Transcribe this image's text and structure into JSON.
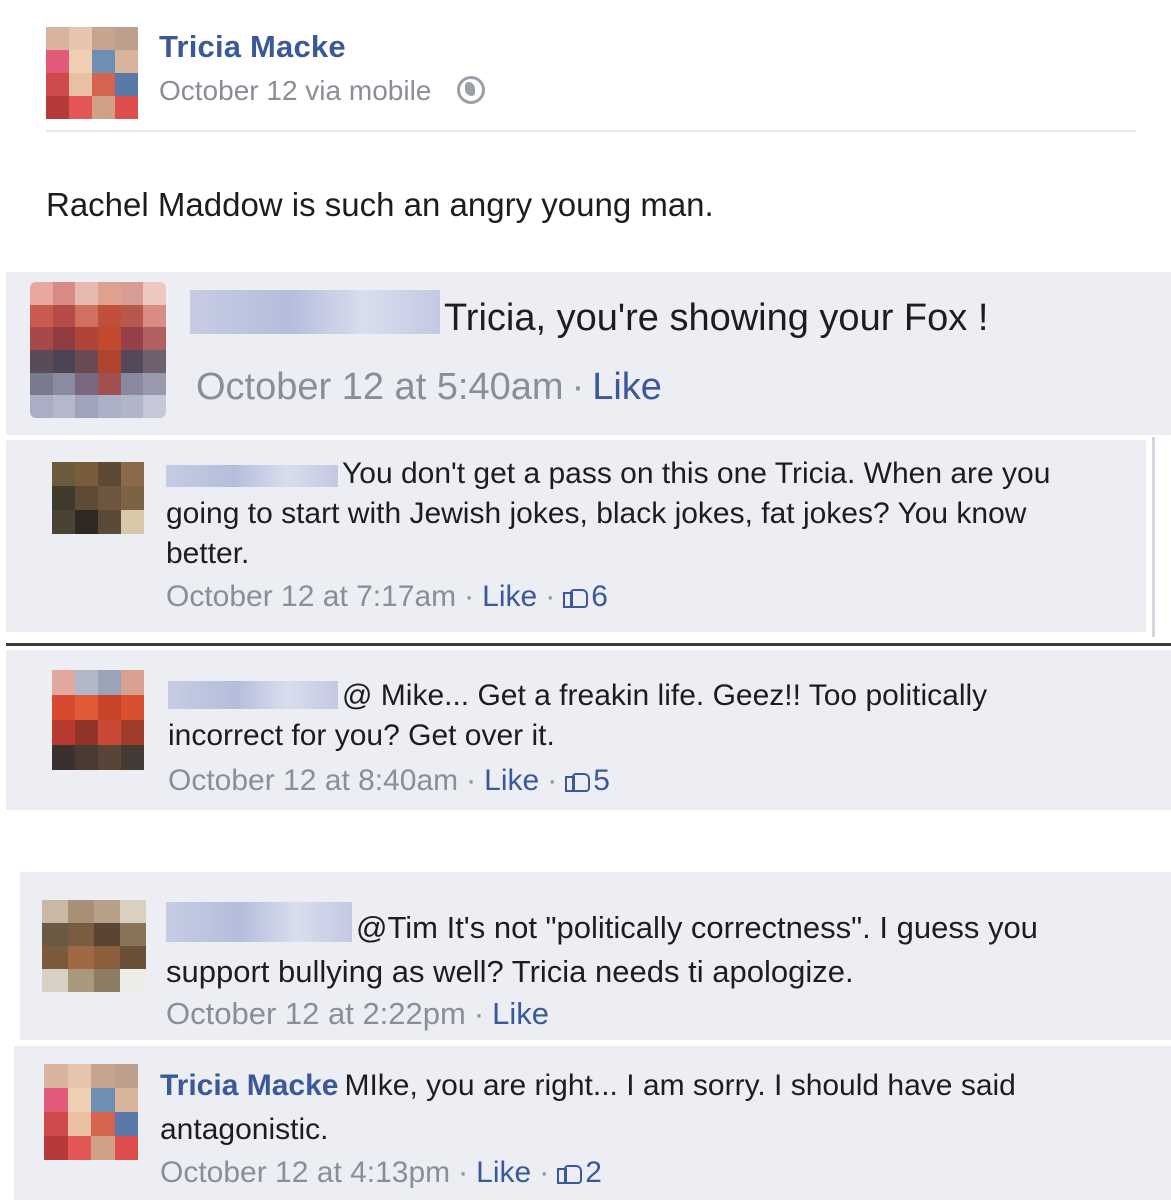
{
  "post": {
    "author": "Tricia Macke",
    "meta": "October 12 via mobile",
    "privacy_icon": "globe-icon",
    "text": "Rachel Maddow is such an angry young man."
  },
  "comments": [
    {
      "text": "Tricia, you're showing your Fox !",
      "time": "October 12 at 5:40am",
      "like_label": "Like"
    },
    {
      "text": "You don't get a pass on this one Tricia. When are you going to start with Jewish jokes, black jokes, fat jokes? You know better.",
      "time": "October 12 at 7:17am",
      "like_label": "Like",
      "likes": "6"
    },
    {
      "text": "@ Mike... Get a freakin life. Geez!! Too politically incorrect for you? Get over it.",
      "time": "October 12 at 8:40am",
      "like_label": "Like",
      "likes": "5"
    },
    {
      "text": "@Tim It's not \"politically correctness\". I guess you support bullying as well? Tricia needs ti apologize.",
      "time": "October 12 at 2:22pm",
      "like_label": "Like"
    },
    {
      "author": "Tricia Macke",
      "text": "MIke, you are right... I am sorry. I should have said antagonistic.",
      "time": "October 12 at 4:13pm",
      "like_label": "Like",
      "likes": "2"
    }
  ],
  "colors": {
    "link": "#3b5998",
    "meta": "#8a8e96",
    "comment_bg": "#eceef4"
  }
}
